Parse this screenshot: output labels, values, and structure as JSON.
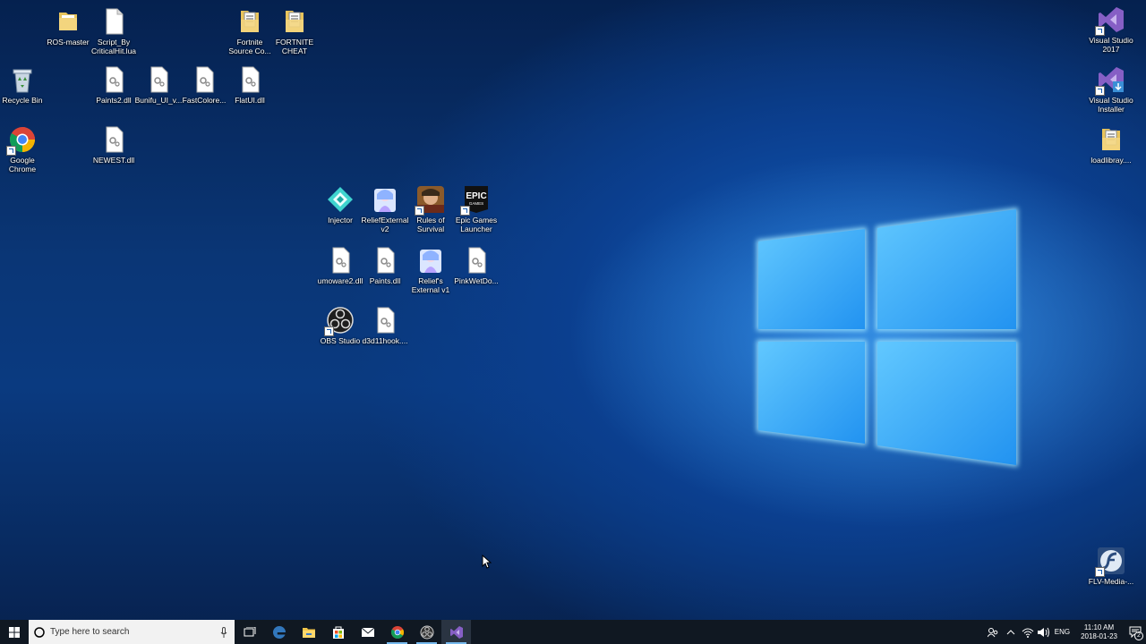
{
  "desktop": {
    "icons": [
      {
        "key": "ros-master",
        "label": "ROS-master",
        "kind": "folder"
      },
      {
        "key": "script-lua",
        "label": "Script_By CriticalHit.lua",
        "kind": "file"
      },
      {
        "key": "fortnite-source",
        "label": "Fortnite Source Co...",
        "kind": "folder-docs"
      },
      {
        "key": "fortnite-cheat",
        "label": "FORTNITE CHEAT",
        "kind": "folder-docs"
      },
      {
        "key": "recycle-bin",
        "label": "Recycle Bin",
        "kind": "recycle"
      },
      {
        "key": "paints2-dll",
        "label": "Paints2.dll",
        "kind": "dll"
      },
      {
        "key": "bunifu-dll",
        "label": "Bunifu_UI_v...",
        "kind": "dll"
      },
      {
        "key": "fastcolored-dll",
        "label": "FastColore...",
        "kind": "dll"
      },
      {
        "key": "flatui-dll",
        "label": "FlatUI.dll",
        "kind": "dll"
      },
      {
        "key": "google-chrome",
        "label": "Google Chrome",
        "kind": "chrome"
      },
      {
        "key": "newest-dll",
        "label": "NEWEST.dll",
        "kind": "dll"
      },
      {
        "key": "injector",
        "label": "Injector",
        "kind": "injector"
      },
      {
        "key": "reliefexternal-v2",
        "label": "ReliefExternal v2",
        "kind": "anime"
      },
      {
        "key": "rules-of-survival",
        "label": "Rules of Survival",
        "kind": "ros"
      },
      {
        "key": "epic-games",
        "label": "Epic Games Launcher",
        "kind": "epic"
      },
      {
        "key": "umoware2-dll",
        "label": "umoware2.dll",
        "kind": "dll"
      },
      {
        "key": "paints-dll",
        "label": "Paints.dll",
        "kind": "dll"
      },
      {
        "key": "reliefs-external-v1",
        "label": "Relief's External v1",
        "kind": "anime"
      },
      {
        "key": "pinkwetdo",
        "label": "PinkWetDo...",
        "kind": "dll"
      },
      {
        "key": "obs-studio",
        "label": "OBS Studio",
        "kind": "obs"
      },
      {
        "key": "d3d11hook",
        "label": "d3d11hook....",
        "kind": "dll"
      },
      {
        "key": "visual-studio-2017",
        "label": "Visual Studio 2017",
        "kind": "vs"
      },
      {
        "key": "vs-installer",
        "label": "Visual Studio Installer",
        "kind": "vsi"
      },
      {
        "key": "loadlibrary",
        "label": "loadlibray....",
        "kind": "folder-docs"
      },
      {
        "key": "flv-media",
        "label": "FLV-Media-...",
        "kind": "flv"
      }
    ]
  },
  "taskbar": {
    "search_placeholder": "Type here to search",
    "pinned": [
      "task-view",
      "edge",
      "file-explorer",
      "store",
      "mail",
      "chrome",
      "obs",
      "visual-studio"
    ],
    "tray_lang": "ENG",
    "clock_time": "11:10 AM",
    "clock_date": "2018-01-23",
    "notification_count": "2"
  },
  "colors": {
    "taskbar": "#101822",
    "accent": "#76b9ed",
    "vs_purple": "#865fc5",
    "folder_yellow": "#f3d57e"
  }
}
